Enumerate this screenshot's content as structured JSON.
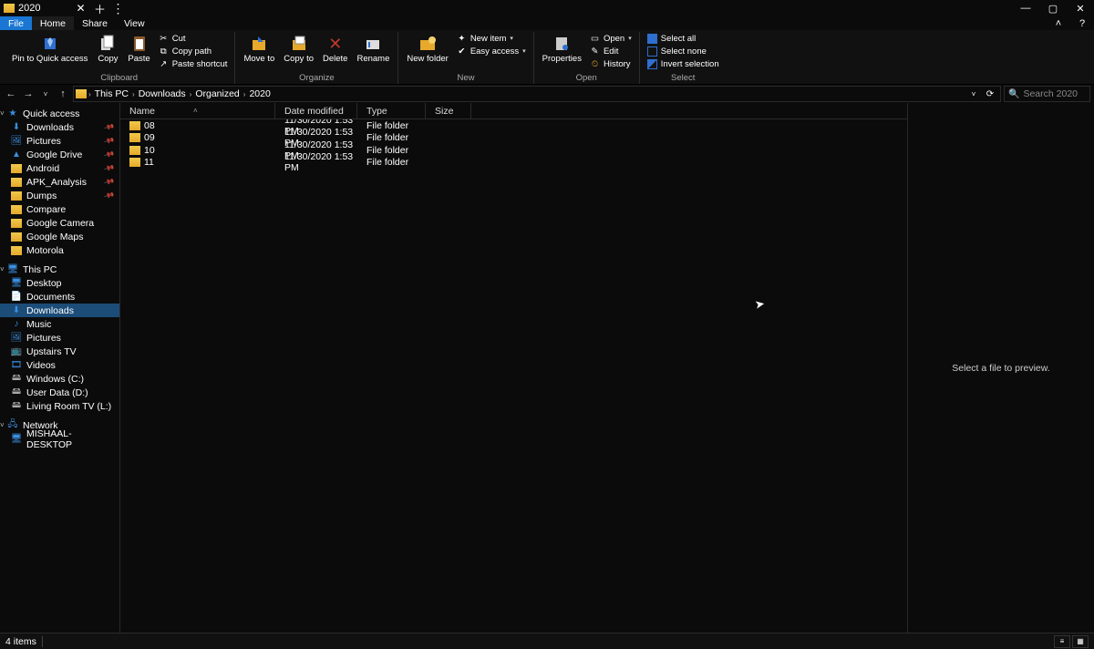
{
  "titlebar": {
    "tab_title": "2020"
  },
  "ribbon_tabs": {
    "file": "File",
    "home": "Home",
    "share": "Share",
    "view": "View"
  },
  "ribbon": {
    "clipboard": {
      "label": "Clipboard",
      "pin": "Pin to Quick access",
      "copy": "Copy",
      "paste": "Paste",
      "cut": "Cut",
      "copy_path": "Copy path",
      "paste_shortcut": "Paste shortcut"
    },
    "organize": {
      "label": "Organize",
      "move_to": "Move to",
      "copy_to": "Copy to",
      "delete": "Delete",
      "rename": "Rename"
    },
    "new": {
      "label": "New",
      "new_folder": "New folder",
      "new_item": "New item",
      "easy_access": "Easy access"
    },
    "open": {
      "label": "Open",
      "properties": "Properties",
      "open": "Open",
      "edit": "Edit",
      "history": "History"
    },
    "select": {
      "label": "Select",
      "select_all": "Select all",
      "select_none": "Select none",
      "invert": "Invert selection"
    }
  },
  "breadcrumb": [
    "This PC",
    "Downloads",
    "Organized",
    "2020"
  ],
  "search": {
    "placeholder": "Search 2020"
  },
  "sidebar": {
    "quick_access": "Quick access",
    "pinned": [
      "Downloads",
      "Pictures",
      "Google Drive",
      "Android",
      "APK_Analysis",
      "Dumps",
      "Compare",
      "Google Camera",
      "Google Maps",
      "Motorola"
    ],
    "pinned_icons": [
      "download",
      "pictures",
      "gdrive",
      "folder",
      "folder",
      "folder",
      "folder",
      "folder",
      "folder",
      "folder"
    ],
    "this_pc": "This PC",
    "pc_items": [
      "Desktop",
      "Documents",
      "Downloads",
      "Music",
      "Pictures",
      "Upstairs TV",
      "Videos",
      "Windows (C:)",
      "User Data (D:)",
      "Living Room TV (L:)"
    ],
    "pc_icons": [
      "desktop",
      "documents",
      "download",
      "music",
      "pictures",
      "tv",
      "videos",
      "disk",
      "disk",
      "disk"
    ],
    "network": "Network",
    "host": "MISHAAL-DESKTOP"
  },
  "columns": {
    "name": "Name",
    "date": "Date modified",
    "type": "Type",
    "size": "Size"
  },
  "rows": [
    {
      "name": "08",
      "date": "11/30/2020 1:53 PM",
      "type": "File folder"
    },
    {
      "name": "09",
      "date": "11/30/2020 1:53 PM",
      "type": "File folder"
    },
    {
      "name": "10",
      "date": "11/30/2020 1:53 PM",
      "type": "File folder"
    },
    {
      "name": "11",
      "date": "11/30/2020 1:53 PM",
      "type": "File folder"
    }
  ],
  "preview": {
    "empty": "Select a file to preview."
  },
  "status": {
    "count": "4 items"
  }
}
